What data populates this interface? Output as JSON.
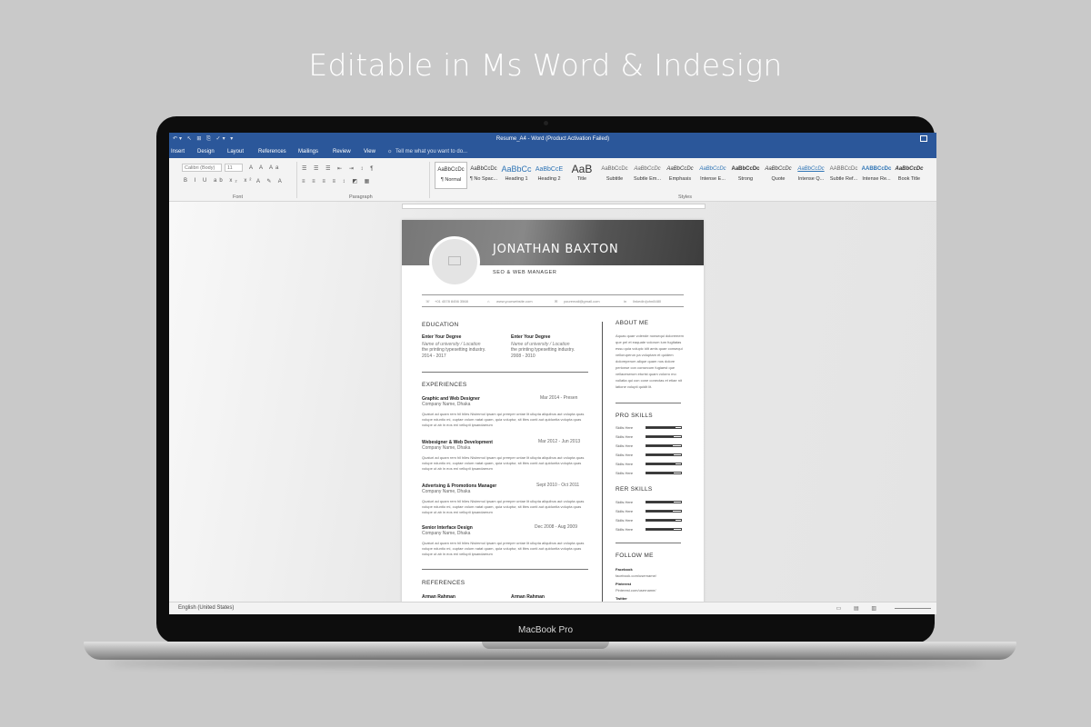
{
  "headline": "Editable in Ms Word & Indesign",
  "laptop": {
    "brand_label": "MacBook Pro"
  },
  "word": {
    "window_title": "Resume_A4 - Word (Product Activation Failed)",
    "tabs": [
      "Insert",
      "Design",
      "Layout",
      "References",
      "Mailings",
      "Review",
      "View"
    ],
    "tell_me": "Tell me what you want to do...",
    "font_name": "Calibri (Body)",
    "font_size": "11",
    "groups": {
      "font": "Font",
      "paragraph": "Paragraph",
      "styles": "Styles"
    },
    "styles": [
      {
        "sample": "AaBbCcDc",
        "label": "¶ Normal"
      },
      {
        "sample": "AaBbCcDc",
        "label": "¶ No Spac..."
      },
      {
        "sample": "AaBbCc",
        "label": "Heading 1"
      },
      {
        "sample": "AaBbCcE",
        "label": "Heading 2"
      },
      {
        "sample": "AaB",
        "label": "Title"
      },
      {
        "sample": "AaBbCcDc",
        "label": "Subtitle"
      },
      {
        "sample": "AaBbCcDc",
        "label": "Subtle Em..."
      },
      {
        "sample": "AaBbCcDc",
        "label": "Emphasis"
      },
      {
        "sample": "AaBbCcDc",
        "label": "Intense E..."
      },
      {
        "sample": "AaBbCcDc",
        "label": "Strong"
      },
      {
        "sample": "AaBbCcDc",
        "label": "Quote"
      },
      {
        "sample": "AaBbCcDc",
        "label": "Intense Q..."
      },
      {
        "sample": "AABBCcDc",
        "label": "Subtle Ref..."
      },
      {
        "sample": "AABBCcDc",
        "label": "Intense Re..."
      },
      {
        "sample": "AaBbCcDc",
        "label": "Book Title"
      }
    ],
    "status_language": "English (United States)"
  },
  "resume": {
    "name": "JONATHAN BAXTON",
    "role": "SEO & WEB MANAGER",
    "contact": [
      "+01 4578 8456 3568",
      "www.yourwebsite.com",
      "youremail@gmail.com",
      "linkedin/john8480"
    ],
    "education": {
      "heading": "EDUCATION",
      "items": [
        {
          "degree": "Enter Your Degree",
          "school": "Name of university / Location",
          "desc": "the printing typesetting industry.",
          "years": "2014 - 2017"
        },
        {
          "degree": "Enter Your Degree",
          "school": "Name of university / Location",
          "desc": "the printing typesetting industry.",
          "years": "2008 - 2010"
        }
      ]
    },
    "experiences": {
      "heading": "EXPERIENCES",
      "body": "Quaturi ad quam rem hil hiles Nisimmol ipsam qui preeper untae lit ullupta aliquibus aut volupta quas volupe nduntio mi, cuptae volum natat quam, quia voluptur, sit lites conti aut quiduntia volupta quas volupe ut ab in eos eni vellupti ipsandaerum",
      "items": [
        {
          "title": "Graphic and Web Designer",
          "company": "Company Name, Dhaka",
          "dates": "Mar 2014 - Presen"
        },
        {
          "title": "Webesigner & Web Development",
          "company": "Company Name, Dhaka",
          "dates": "Mar 2012 - Jun 2013"
        },
        {
          "title": "Advertsing & Promotions Manager",
          "company": "Company Name, Dhaka",
          "dates": "Sept 2010 - Oct 2011"
        },
        {
          "title": "Senior Interface Design",
          "company": "Company Name, Dhaka",
          "dates": "Dec 2008 - Aug 2009"
        }
      ]
    },
    "references": {
      "heading": "REFERENCES",
      "names": [
        "Arman Rahman",
        "Arman Rahman"
      ]
    },
    "about": {
      "heading": "ABOUT ME",
      "text": "Aquas quae volende nonsequi doloremem que pel et eaquate volorum ium fugitatas essu quia volupic idit amis quae consequi velloruperun pa voluptam et quidem doloreperum alique quam nos dolore perionse con consecum fugiaest que vellaceserum eturist quam volorro mo vollatia qui con cone conectas et etiae nit latione volupti quidit lit."
    },
    "pro_skills": {
      "heading": "PRO SKILLS",
      "items": [
        {
          "label": "Skills Here",
          "level": 0.85
        },
        {
          "label": "Skills Here",
          "level": 0.8
        },
        {
          "label": "Skills Here",
          "level": 0.75
        },
        {
          "label": "Skills Here",
          "level": 0.8
        },
        {
          "label": "Skills Here",
          "level": 0.85
        },
        {
          "label": "Skills Here",
          "level": 0.8
        }
      ]
    },
    "rer_skills": {
      "heading": "RER SKILLS",
      "items": [
        {
          "label": "Skills Here",
          "level": 0.8
        },
        {
          "label": "Skills Here",
          "level": 0.75
        },
        {
          "label": "Skills Here",
          "level": 0.85
        },
        {
          "label": "Skills Here",
          "level": 0.8
        }
      ]
    },
    "follow": {
      "heading": "FOLLOW ME",
      "items": [
        {
          "network": "Facebook",
          "url": "facebook.com/username/"
        },
        {
          "network": "Pinterest",
          "url": "Pinterest.com/username/"
        },
        {
          "network": "Twitter",
          "url": ""
        }
      ]
    }
  }
}
